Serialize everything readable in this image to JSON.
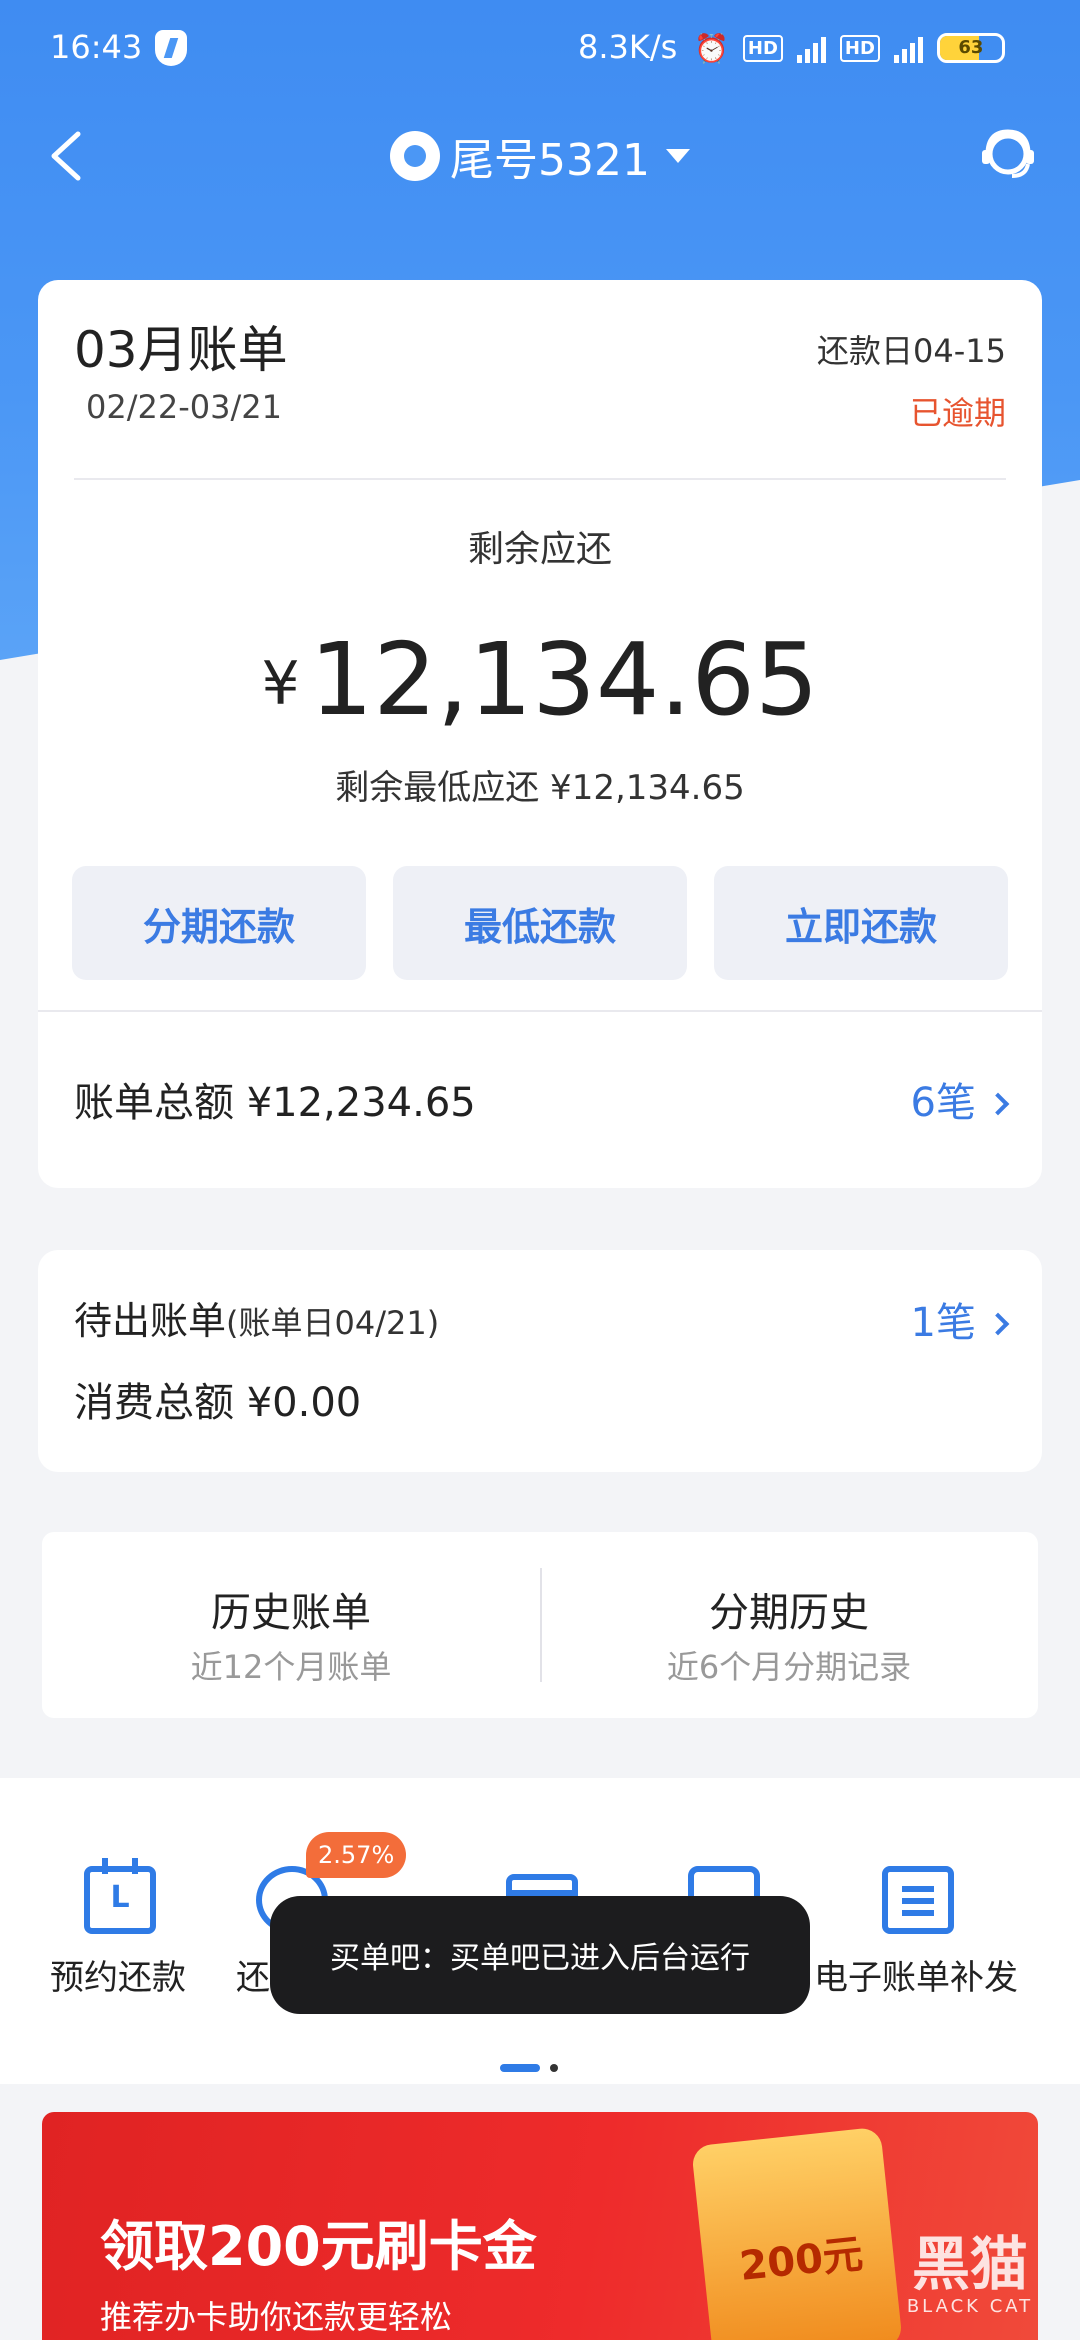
{
  "status_bar": {
    "time": "16:43",
    "net_speed": "8.3K/s",
    "hd": "HD",
    "network": "4G",
    "battery": "63",
    "battery_level": 0.63
  },
  "nav": {
    "title": "尾号5321"
  },
  "bill": {
    "month_title": "03月账单",
    "period": "02/22-03/21",
    "due_date": "还款日04-15",
    "status": "已逾期",
    "remaining_label": "剩余应还",
    "currency": "¥",
    "remaining_amount": "12,134.65",
    "min_due": "剩余最低应还 ¥12,134.65",
    "buttons": [
      "分期还款",
      "最低还款",
      "立即还款"
    ],
    "total_label": "账单总额 ¥12,234.65",
    "total_count": "6笔"
  },
  "pending": {
    "title": "待出账单",
    "bill_day": "(账单日04/21)",
    "count": "1笔",
    "consume_label": "消费总额 ¥0.00"
  },
  "history": {
    "items": [
      {
        "title": "历史账单",
        "sub": "近12个月账单"
      },
      {
        "title": "分期历史",
        "sub": "近6个月分期记录"
      }
    ]
  },
  "quick": {
    "items": [
      {
        "label": "预约还款",
        "icon": "calendar-icon"
      },
      {
        "label": "还",
        "icon": "piggy-bank-icon"
      },
      {
        "label": "",
        "icon": "card-icon"
      },
      {
        "label": "",
        "icon": "shield-icon"
      },
      {
        "label": "电子账单补发",
        "icon": "document-icon"
      }
    ],
    "rate_badge": "2.57%",
    "calendar_letter": "L"
  },
  "toast": {
    "text": "买单吧：买单吧已进入后台运行"
  },
  "banner": {
    "title": "领取200元刷卡金",
    "subtitle": "推荐办卡助你还款更轻松",
    "amount": "200元"
  },
  "watermark": {
    "cn": "黑猫",
    "en": "BLACK CAT"
  },
  "colors": {
    "primary_blue": "#3b7be3",
    "header_blue": "#4b97f5",
    "overdue_red": "#e7542f",
    "banner_red": "#e02323"
  }
}
